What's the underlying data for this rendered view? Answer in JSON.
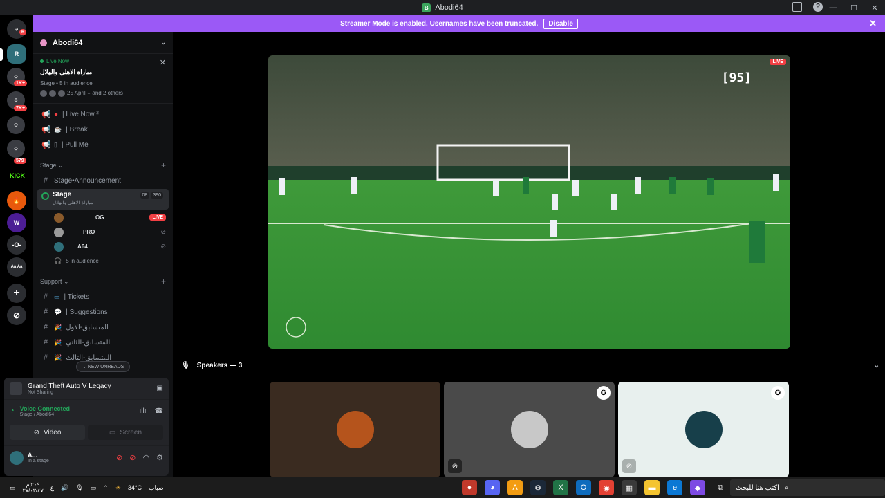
{
  "window": {
    "title": "Abodi64"
  },
  "banner": {
    "text": "Streamer Mode is enabled. Usernames have been truncated.",
    "disable_label": "Disable"
  },
  "rail": {
    "badges": [
      "6",
      "1K+",
      "7K+",
      "579"
    ],
    "kick_label": "KICK"
  },
  "guild": {
    "name": "Abodi64"
  },
  "live_card": {
    "status": "Live Now",
    "title": "مباراة الاهلي والهلال",
    "stage_label": "Stage",
    "audience": "5 in audience",
    "attendees": "25 April ⌣ and 2 others"
  },
  "channels_top": [
    {
      "label": "| Live Now ²",
      "icon": "megaphone-icon"
    },
    {
      "label": "| Break",
      "icon": "megaphone-icon"
    },
    {
      "label": "| Pull Me",
      "icon": "megaphone-icon"
    }
  ],
  "stage_category": {
    "label": "Stage ⌄",
    "announcement": "Stage•Announcement",
    "selected_channel": {
      "name": "Stage",
      "subtitle": "مباراة الاهلي والهلال",
      "count_a": "08",
      "count_b": "390"
    },
    "members": [
      {
        "name": "OG",
        "tag": "LIVE"
      },
      {
        "name": "PRO",
        "tag": ""
      },
      {
        "name": "A64",
        "tag": ""
      }
    ],
    "audience": "5 in audience"
  },
  "support_category": {
    "label": "Support ⌄",
    "channels": [
      {
        "label": "| Tickets"
      },
      {
        "label": "| Suggestions"
      },
      {
        "label": "المتسابق-الاول"
      },
      {
        "label": "المتسابق-الثاني"
      },
      {
        "label": "المتسابق-الثالث"
      }
    ]
  },
  "new_unreads": "NEW UNREADS",
  "activity": {
    "game": "Grand Theft Auto V Legacy",
    "status": "Not Sharing"
  },
  "voice": {
    "status": "Voice Connected",
    "location": "Stage / Abodi64"
  },
  "av_buttons": {
    "video": "Video",
    "screen": "Screen"
  },
  "user": {
    "name": "A...",
    "status": "In a stage"
  },
  "stream": {
    "live_tag": "LIVE",
    "watermark": "[95]"
  },
  "speakers": {
    "label": "Speakers — 3"
  },
  "taskbar": {
    "time": "٥:٠٩م",
    "date": "٢٧/٠٣/٤٧",
    "temp": "34°C",
    "weather": "ضباب",
    "search_placeholder": "اكتب هنا للبحث"
  },
  "colors": {
    "banner": "#9b59f6",
    "live": "#f23f43",
    "online": "#23a55a"
  }
}
